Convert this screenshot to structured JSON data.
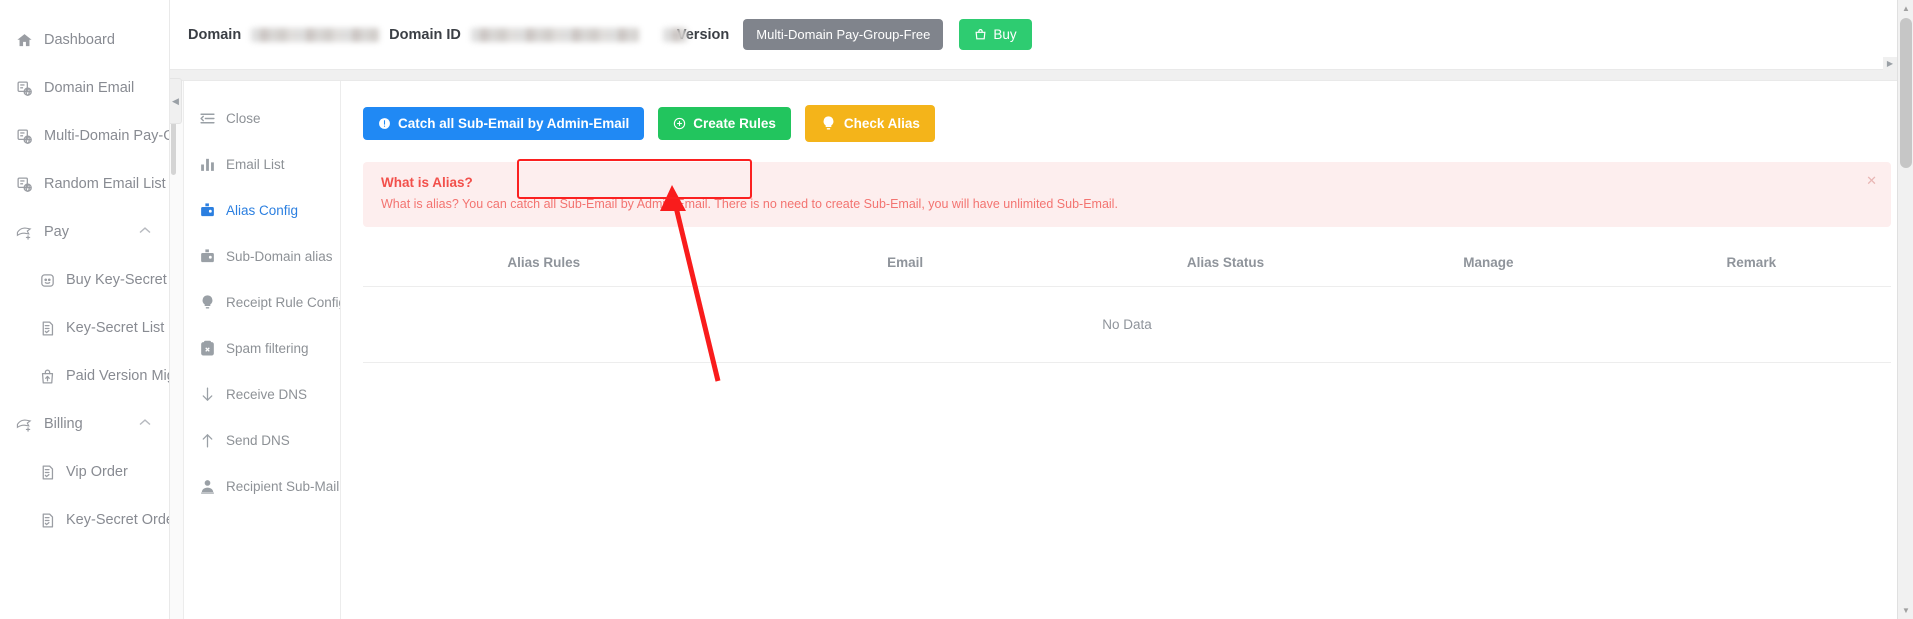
{
  "sidebar": {
    "items": [
      {
        "label": "Dashboard",
        "icon": "home-icon",
        "level": 0,
        "caret": ""
      },
      {
        "label": "Domain Email",
        "icon": "domain-email-icon",
        "level": 0,
        "caret": ""
      },
      {
        "label": "Multi-Domain Pay-Group",
        "icon": "domain-email-icon",
        "level": 0,
        "caret": ""
      },
      {
        "label": "Random Email List",
        "icon": "domain-email-icon",
        "level": 0,
        "caret": ""
      },
      {
        "label": "Pay",
        "icon": "pay-icon",
        "level": 0,
        "caret": "chevron-up-icon"
      },
      {
        "label": "Buy Key-Secret",
        "icon": "buy-key-icon",
        "level": 1,
        "caret": ""
      },
      {
        "label": "Key-Secret List",
        "icon": "list-doc-icon",
        "level": 1,
        "caret": ""
      },
      {
        "label": "Paid Version Migration",
        "icon": "upgrade-bag-icon",
        "level": 1,
        "caret": ""
      },
      {
        "label": "Billing",
        "icon": "pay-icon",
        "level": 0,
        "caret": "chevron-up-icon"
      },
      {
        "label": "Vip Order",
        "icon": "list-doc-icon",
        "level": 1,
        "caret": ""
      },
      {
        "label": "Key-Secret Order",
        "icon": "list-doc-icon",
        "level": 1,
        "caret": ""
      }
    ]
  },
  "header": {
    "domain_label": "Domain",
    "domain_value": "",
    "domain_id_label": "Domain ID",
    "domain_id_value": "",
    "version_label": "Version",
    "version_badge": "Multi-Domain Pay-Group-Free",
    "buy_label": "Buy",
    "buy_icon": "shopping-bag-icon",
    "buy_color": "#2ecc71",
    "badge_color": "#80848c"
  },
  "submenu": {
    "items": [
      {
        "label": "Close",
        "icon": "collapse-list-icon",
        "active": false
      },
      {
        "label": "Email List",
        "icon": "bar-chart-icon",
        "active": false
      },
      {
        "label": "Alias Config",
        "icon": "wallet-icon",
        "active": true
      },
      {
        "label": "Sub-Domain alias",
        "icon": "wallet-icon",
        "active": false
      },
      {
        "label": "Receipt Rule Config",
        "icon": "bulb-icon",
        "active": false
      },
      {
        "label": "Spam filtering",
        "icon": "clipboard-x-icon",
        "active": false
      },
      {
        "label": "Receive DNS",
        "icon": "arrow-down-icon",
        "active": false
      },
      {
        "label": "Send DNS",
        "icon": "arrow-up-icon",
        "active": false
      },
      {
        "label": "Recipient Sub-Mail",
        "icon": "user-icon",
        "active": false
      }
    ],
    "active_color": "#2b7fe0"
  },
  "toolbar": {
    "buttons": [
      {
        "label": "Catch all Sub-Email by Admin-Email",
        "icon": "exclamation-circle-icon",
        "color": "#2089f4",
        "variant": "primary"
      },
      {
        "label": "Create Rules",
        "icon": "plus-circle-icon",
        "color": "#22c55e",
        "variant": "success"
      },
      {
        "label": "Check Alias",
        "icon": "bulb-icon",
        "color": "#f4b41a",
        "variant": "warn"
      }
    ]
  },
  "alert": {
    "title": "What is Alias?",
    "description": "What is alias? You can catch all Sub-Email by Admin-Email. There is no need to create Sub-Email, you will have unlimited Sub-Email.",
    "close_icon": "close-icon",
    "bg_color": "#fdeeee",
    "text_color": "#f2655f"
  },
  "table": {
    "columns": [
      "Alias Rules",
      "Email",
      "Alias Status",
      "Manage",
      "Remark"
    ],
    "rows": [],
    "empty_text": "No Data"
  },
  "annotation": {
    "highlight_color": "#fb2020",
    "arrow_color": "#f91c1c"
  }
}
